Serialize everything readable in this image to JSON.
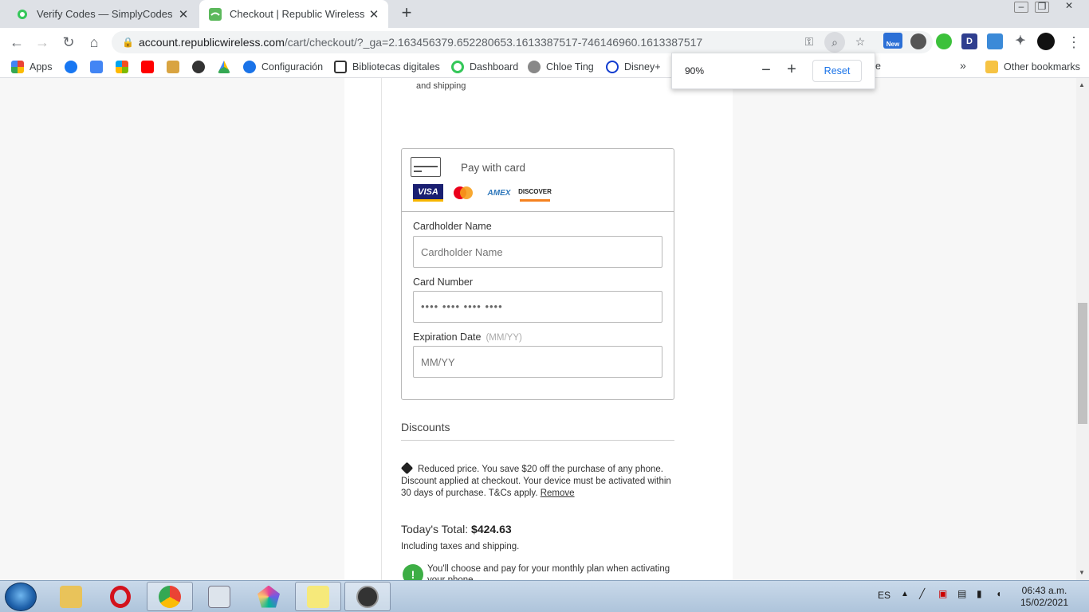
{
  "tabs": [
    {
      "title": "Verify Codes — SimplyCodes",
      "icon": "simplycodes-favicon",
      "color": "#34c759"
    },
    {
      "title": "Checkout | Republic Wireless",
      "icon": "republic-wireless-favicon",
      "color": "#5cb85c"
    }
  ],
  "window_controls": {
    "minimize": "‒",
    "restore": "❐",
    "close": "✕"
  },
  "address_bar": {
    "host": "account.republicwireless.com",
    "path": "/cart/checkout/?_ga=2.163456379.652280653.1613387517-746146960.1613387517"
  },
  "extensions": {
    "new_badge": "New",
    "d_label": "D"
  },
  "bookmarks": [
    {
      "label": "Apps",
      "icon": "apps-grid-icon"
    },
    {
      "label": "",
      "icon": "facebook-icon"
    },
    {
      "label": "",
      "icon": "google-translate-icon"
    },
    {
      "label": "",
      "icon": "microsoft-icon"
    },
    {
      "label": "",
      "icon": "youtube-icon"
    },
    {
      "label": "",
      "icon": "mail-icon"
    },
    {
      "label": "",
      "icon": "spy-icon"
    },
    {
      "label": "",
      "icon": "google-drive-icon"
    },
    {
      "label": "Configuración",
      "icon": "gear-icon"
    },
    {
      "label": "Bibliotecas digitales",
      "icon": "book-icon"
    },
    {
      "label": "Dashboard",
      "icon": "simplycodes-icon"
    },
    {
      "label": "Chloe Ting",
      "icon": "chloe-ting-icon"
    },
    {
      "label": "Disney+",
      "icon": "disney-icon"
    },
    {
      "label": "e",
      "icon": ""
    }
  ],
  "bookmarks_overflow": "»",
  "other_bookmarks": "Other bookmarks",
  "zoom_popup": {
    "level": "90%",
    "minus": "−",
    "plus": "+",
    "reset": "Reset"
  },
  "page": {
    "shipping_tail": "and shipping",
    "pay_with_card": "Pay with card",
    "card_brands": [
      "VISA",
      "MasterCard",
      "AMEX",
      "DISCOVER"
    ],
    "cardholder_label": "Cardholder Name",
    "cardholder_placeholder": "Cardholder Name",
    "card_number_label": "Card Number",
    "card_number_mask": "•••• •••• •••• ••••",
    "expiration_label": "Expiration Date",
    "expiration_hint": "(MM/YY)",
    "expiration_placeholder": "MM/YY",
    "discounts_title": "Discounts",
    "discount_text": "Reduced price. You save $20 off the purchase of any phone. Discount applied at checkout. Your device must be activated within 30 days of purchase. T&Cs apply.",
    "remove_link": "Remove",
    "total_label": "Today's Total:",
    "total_value": "$424.63",
    "total_sub": "Including taxes and shipping.",
    "note_text": "You'll choose and pay for your monthly plan when activating your phone.",
    "note_icon_glyph": "!"
  },
  "taskbar": {
    "language": "ES",
    "time": "06:43 a.m.",
    "date": "15/02/2021"
  },
  "colors": {
    "accent_blue": "#1a73e8",
    "success_green": "#3dae45"
  }
}
